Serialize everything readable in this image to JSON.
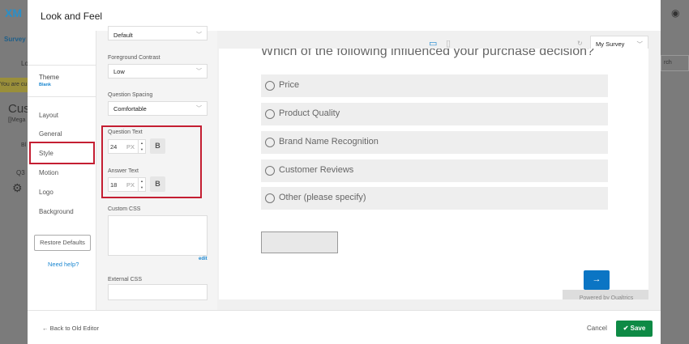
{
  "background": {
    "logo": "XM",
    "tab": "Survey",
    "tool": "Lo",
    "notice": "You are cu",
    "title": "Cust",
    "subtitle": "[[Mega",
    "block": "Bl",
    "question": "Q3",
    "search": "rch"
  },
  "modal": {
    "title": "Look and Feel"
  },
  "nav": {
    "theme_label": "Theme",
    "theme_value": "Blank",
    "items": [
      "Layout",
      "General",
      "Style",
      "Motion",
      "Logo",
      "Background"
    ],
    "active": "Style",
    "restore": "Restore Defaults",
    "help": "Need help?"
  },
  "settings": {
    "top_select": "Default",
    "foreground_label": "Foreground Contrast",
    "foreground_value": "Low",
    "spacing_label": "Question Spacing",
    "spacing_value": "Comfortable",
    "question_text_label": "Question Text",
    "question_text_size": "24",
    "answer_text_label": "Answer Text",
    "answer_text_size": "18",
    "unit": "PX",
    "bold": "B",
    "custom_css_label": "Custom CSS",
    "edit": "edit",
    "external_css_label": "External CSS"
  },
  "preview": {
    "survey_select": "My Survey",
    "question": "Which of the following influenced your purchase decision?",
    "options": [
      "Price",
      "Product Quality",
      "Brand Name Recognition",
      "Customer Reviews",
      "Other (please specify)"
    ],
    "next": "→",
    "powered": "Powered by Qualtrics"
  },
  "footer": {
    "back": "← Back to Old Editor",
    "cancel": "Cancel",
    "save": "Save"
  },
  "colors": {
    "accent": "#1b87d1",
    "save": "#0e8a45",
    "highlight": "#c41e32",
    "next": "#0b75c4"
  }
}
